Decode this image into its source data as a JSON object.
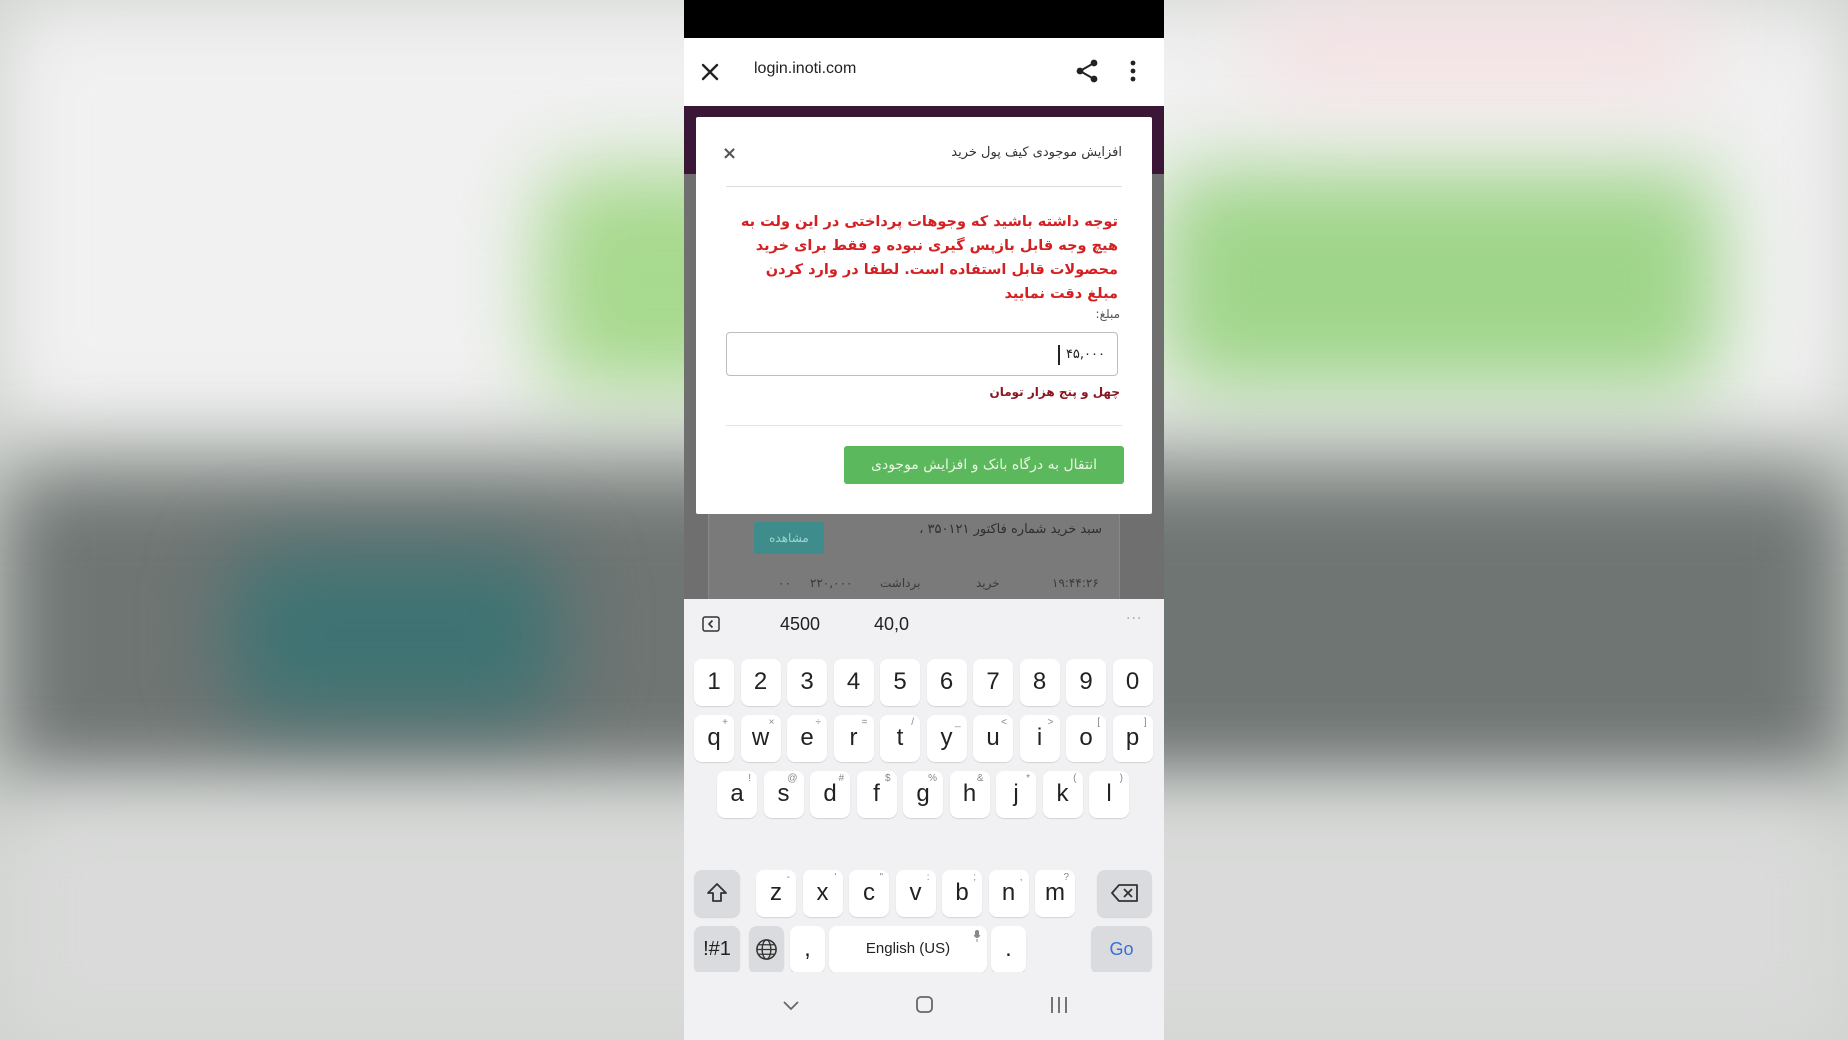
{
  "browser": {
    "url": "login.inoti.com"
  },
  "modal": {
    "title": "افزایش موجودی کیف پول خرید",
    "close_glyph": "×",
    "warning": "توجه داشته باشید که وجوهات پرداختی در این ولت به هیچ وجه قابل بازپس گیری نبوده و فقط برای خرید محصولات قابل استفاده است. لطفا در وارد کردن مبلغ دقت نمایید",
    "amount_label": "مبلغ:",
    "amount_value": "۴۵,۰۰۰",
    "amount_words": "چهل و پنج هزار تومان",
    "submit_label": "انتقال به درگاه بانک و افزایش موجودی"
  },
  "background_page": {
    "invoice_text": "سبد خرید شماره فاکتور ۳۵۰۱۲۱ ،",
    "view_button": "مشاهده",
    "row": {
      "time": "۱۹:۴۴:۲۶",
      "type": "خرید",
      "action": "برداشت",
      "amount": "۲۲۰,۰۰۰",
      "balance": "۰۰"
    }
  },
  "keyboard": {
    "suggestions": [
      "4500",
      "40,0"
    ],
    "more_glyph": "···",
    "row1": [
      {
        "k": "1"
      },
      {
        "k": "2"
      },
      {
        "k": "3"
      },
      {
        "k": "4"
      },
      {
        "k": "5"
      },
      {
        "k": "6"
      },
      {
        "k": "7"
      },
      {
        "k": "8"
      },
      {
        "k": "9"
      },
      {
        "k": "0"
      }
    ],
    "row2": [
      {
        "k": "q",
        "s": "+"
      },
      {
        "k": "w",
        "s": "×"
      },
      {
        "k": "e",
        "s": "÷"
      },
      {
        "k": "r",
        "s": "="
      },
      {
        "k": "t",
        "s": "/"
      },
      {
        "k": "y",
        "s": "_"
      },
      {
        "k": "u",
        "s": "<"
      },
      {
        "k": "i",
        "s": ">"
      },
      {
        "k": "o",
        "s": "["
      },
      {
        "k": "p",
        "s": "]"
      }
    ],
    "row3": [
      {
        "k": "a",
        "s": "!"
      },
      {
        "k": "s",
        "s": "@"
      },
      {
        "k": "d",
        "s": "#"
      },
      {
        "k": "f",
        "s": "$"
      },
      {
        "k": "g",
        "s": "%"
      },
      {
        "k": "h",
        "s": "&"
      },
      {
        "k": "j",
        "s": "*"
      },
      {
        "k": "k",
        "s": "("
      },
      {
        "k": "l",
        "s": ")"
      }
    ],
    "row4": [
      {
        "k": "z",
        "s": "-"
      },
      {
        "k": "x",
        "s": "'"
      },
      {
        "k": "c",
        "s": "\""
      },
      {
        "k": "v",
        "s": ":"
      },
      {
        "k": "b",
        "s": ";"
      },
      {
        "k": "n",
        "s": ","
      },
      {
        "k": "m",
        "s": "?"
      }
    ],
    "symbols_label": "!#1",
    "comma": ",",
    "space_label": "English (US)",
    "period": ".",
    "go_label": "Go"
  },
  "colors": {
    "warning_red": "#d42022",
    "submit_green": "#5cb85c",
    "go_blue": "#3a6fd8",
    "header_purple": "#3a1736"
  }
}
